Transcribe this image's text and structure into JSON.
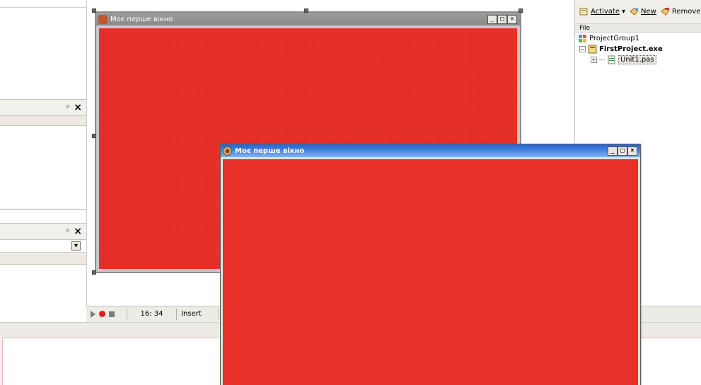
{
  "designer": {
    "form_caption": "Моє перше вікно",
    "caption_buttons": {
      "minimize": "_",
      "maximize": "□",
      "close": "×"
    }
  },
  "running_window": {
    "caption": "Моє перше вікно",
    "caption_buttons": {
      "minimize": "_",
      "maximize": "□",
      "close": "×"
    }
  },
  "left_panels": [
    {
      "pin": "ᵖ",
      "close": "×"
    },
    {
      "pin": "ᵖ",
      "close": "×",
      "dropdown_arrow": "▾"
    }
  ],
  "status_bar": {
    "cursor_position": "16: 34",
    "mode": "Insert"
  },
  "project_manager": {
    "toolbar": {
      "activate_label": "Activate",
      "dropdown_arrow": "▾",
      "new_label": "New",
      "remove_label": "Remove"
    },
    "column_header": "File",
    "tree": {
      "group": "ProjectGroup1",
      "project": "FirstProject.exe",
      "unit": "Unit1.pas",
      "expand_minus": "−",
      "expand_plus": "+"
    }
  },
  "colors": {
    "form_color": "#e8302a",
    "xp_title_blue": "#3c7dde",
    "record_red": "#e21c1c"
  }
}
